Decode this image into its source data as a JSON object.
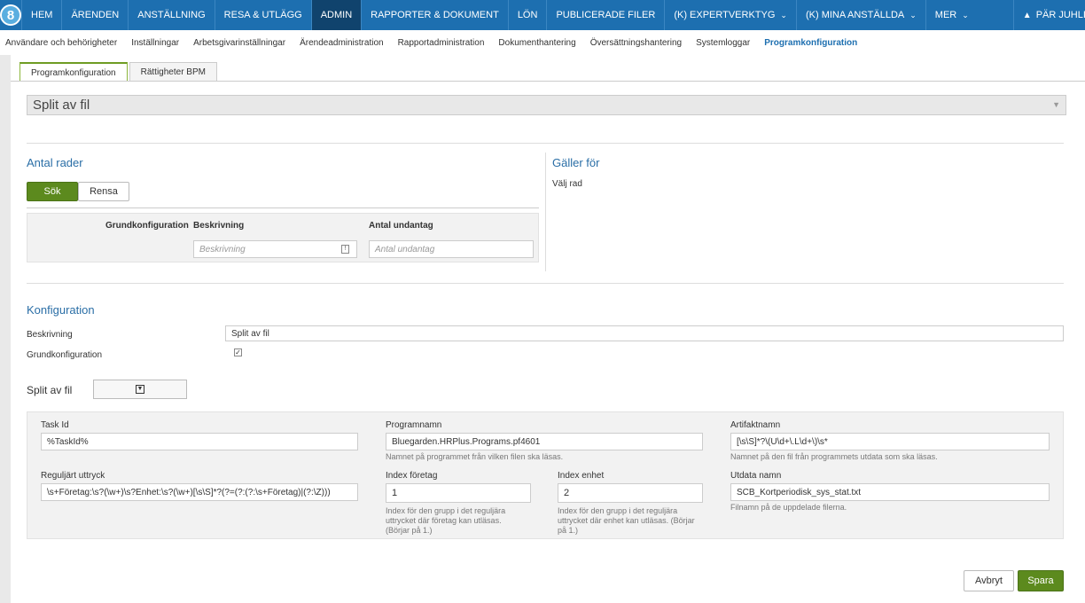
{
  "topnav": {
    "items": [
      "HEM",
      "ÄRENDEN",
      "ANSTÄLLNING",
      "RESA & UTLÄGG",
      "ADMIN",
      "RAPPORTER & DOKUMENT",
      "LÖN",
      "PUBLICERADE FILER",
      "(K) EXPERTVERKTYG",
      "(K) MINA ANSTÄLLDA",
      "MER"
    ],
    "user": "PÄR JUHLIN",
    "accent": "#1d6fb0"
  },
  "subnav": {
    "items": [
      "Användare och behörigheter",
      "Inställningar",
      "Arbetsgivarinställningar",
      "Ärendeadministration",
      "Rapportadministration",
      "Dokumenthantering",
      "Översättningshantering",
      "Systemloggar",
      "Programkonfiguration"
    ]
  },
  "tabs": [
    "Programkonfiguration",
    "Rättigheter BPM"
  ],
  "selector": {
    "value": "Split av fil"
  },
  "antal_rader": {
    "title": "Antal rader",
    "search_label": "Sök",
    "clear_label": "Rensa",
    "columns": [
      "Grundkonfiguration",
      "Beskrivning",
      "Antal undantag"
    ],
    "beskrivning_placeholder": "Beskrivning",
    "antal_placeholder": "Antal undantag"
  },
  "galler_for": {
    "title": "Gäller för",
    "text": "Välj rad"
  },
  "konfiguration": {
    "title": "Konfiguration",
    "beskrivning_label": "Beskrivning",
    "beskrivning_value": "Split av fil",
    "grund_label": "Grundkonfiguration",
    "grund_checked": true
  },
  "split": {
    "label": "Split av fil",
    "fields": {
      "task_id_label": "Task Id",
      "task_id_value": "%TaskId%",
      "programnamn_label": "Programnamn",
      "programnamn_value": "Bluegarden.HRPlus.Programs.pf4601",
      "programnamn_help": "Namnet på programmet från vilken filen ska läsas.",
      "artifakt_label": "Artifaktnamn",
      "artifakt_value": "[\\s\\S]*?\\(U\\d+\\.L\\d+\\)\\s*",
      "artifakt_help": "Namnet på den fil från programmets utdata som ska läsas.",
      "regex_label": "Reguljärt uttryck",
      "regex_value": "\\s+Företag:\\s?(\\w+)\\s?Enhet:\\s?(\\w+)[\\s\\S]*?(?=(?:(?:\\s+Företag)|(?:\\Z)))",
      "index_foretag_label": "Index företag",
      "index_foretag_value": "1",
      "index_foretag_help": "Index för den grupp i det reguljära uttrycket där företag kan utläsas. (Börjar på 1.)",
      "index_enhet_label": "Index enhet",
      "index_enhet_value": "2",
      "index_enhet_help": "Index för den grupp i det reguljära uttrycket där enhet kan utläsas. (Börjar på 1.)",
      "utdata_label": "Utdata namn",
      "utdata_value": "SCB_Kortperiodisk_sys_stat.txt",
      "utdata_help": "Filnamn på de uppdelade filerna."
    }
  },
  "footer": {
    "cancel_label": "Avbryt",
    "save_label": "Spara"
  }
}
